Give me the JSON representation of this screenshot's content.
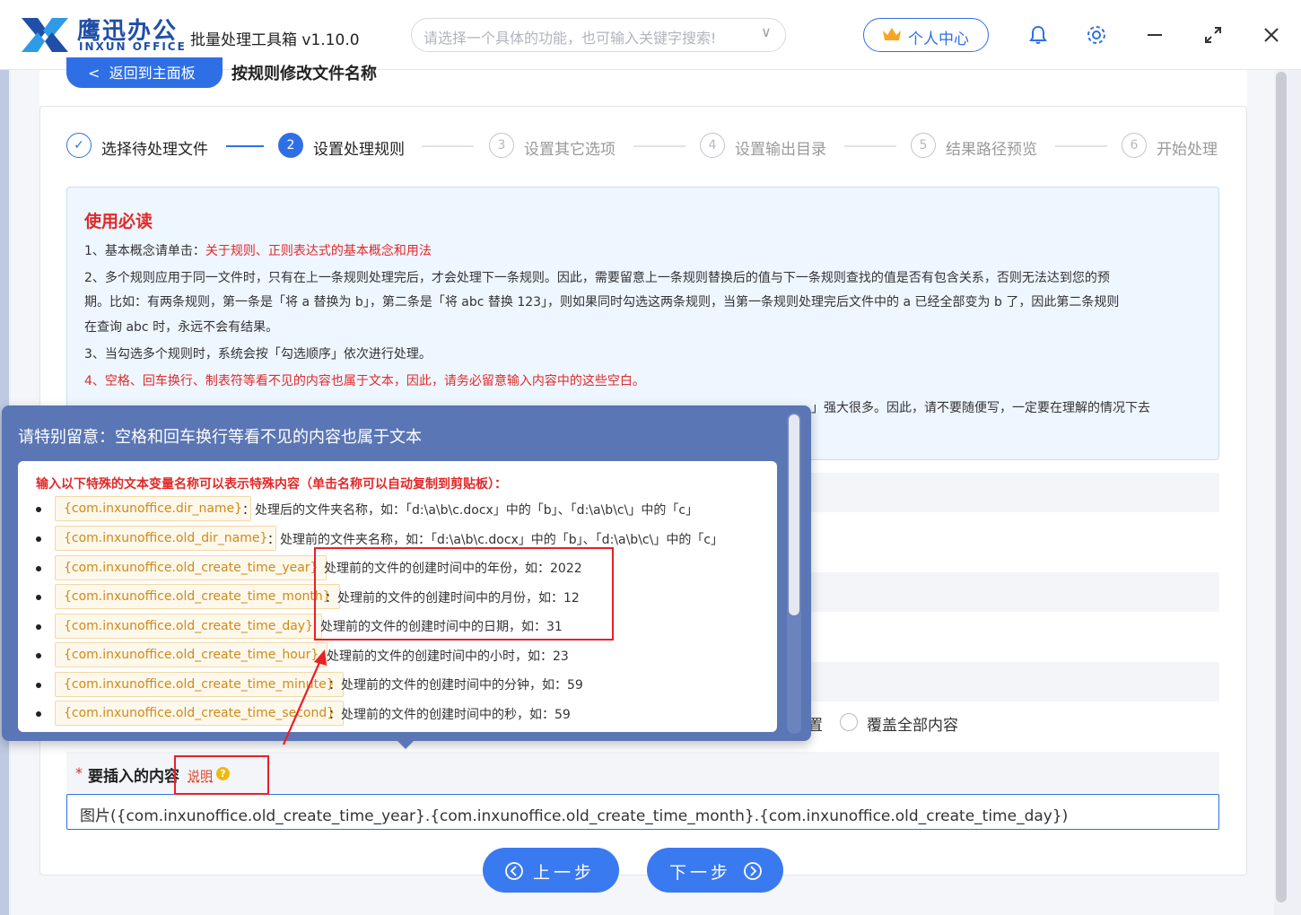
{
  "app": {
    "logo_cn": "鹰迅办公",
    "logo_en": "INXUN OFFICE",
    "name": "批量处理工具箱 v1.10.0",
    "search_placeholder": "请选择一个具体的功能，也可输入关键字搜索!",
    "personal_center": "个人中心",
    "icons": [
      "bell-icon",
      "gear-icon",
      "minimize-icon",
      "expand-icon",
      "close-icon"
    ]
  },
  "header": {
    "back_button": "返回到主面板",
    "page_title": "按规则修改文件名称"
  },
  "steps": [
    {
      "num": "✓",
      "label": "选择待处理文件",
      "state": "done"
    },
    {
      "num": "2",
      "label": "设置处理规则",
      "state": "active"
    },
    {
      "num": "3",
      "label": "设置其它选项",
      "state": "todo"
    },
    {
      "num": "4",
      "label": "设置输出目录",
      "state": "todo"
    },
    {
      "num": "5",
      "label": "结果路径预览",
      "state": "todo"
    },
    {
      "num": "6",
      "label": "开始处理",
      "state": "todo"
    }
  ],
  "notice": {
    "title": "使用必读",
    "line1_prefix": "1、基本概念请单击：",
    "line1_link": "关于规则、正则表达式的基本概念和用法",
    "line2a": "2、多个规则应用于同一文件时，只有在上一条规则处理完后，才会处理下一条规则。因此，需要留意上一条规则替换后的值与下一条规则查找的值是否有包含关系，否则无法达到您的预",
    "line2b": "期。比如：有两条规则，第一条是「将 a 替换为 b」，第二条是「将 abc 替换 123」，则如果同时勾选这两条规则，当第一条规则处理完后文件中的 a 已经全部变为 b 了，因此第二条规则",
    "line2c": "在查询 abc 时，永远不会有结果。",
    "line3": "3、当勾选多个规则时，系统会按「勾选顺序」依次进行处理。",
    "line4": "4、空格、回车换行、制表符等看不见的内容也属于文本，因此，请务必留意输入内容中的这些空白。",
    "line5_tail": "」强大很多。因此，请不要随便写，一定要在理解的情况下去"
  },
  "popup": {
    "title": "请特别留意：空格和回车换行等看不见的内容也属于文本",
    "heading": "输入以下特殊的文本变量名称可以表示特殊内容（单击名称可以自动复制到剪贴板）：",
    "items": [
      {
        "tag": "{com.inxunoffice.dir_name}",
        "desc": "：处理后的文件夹名称，如：「d:\\a\\b\\c.docx」中的「b」、「d:\\a\\b\\c\\」中的「c」"
      },
      {
        "tag": "{com.inxunoffice.old_dir_name}",
        "desc": "：处理前的文件夹名称，如：「d:\\a\\b\\c.docx」中的「b」、「d:\\a\\b\\c\\」中的「c」"
      },
      {
        "tag": "{com.inxunoffice.old_create_time_year}",
        "desc": "处理前的文件的创建时间中的年份，如：2022"
      },
      {
        "tag": "{com.inxunoffice.old_create_time_month}",
        "desc": "：处理前的文件的创建时间中的月份，如：12"
      },
      {
        "tag": "{com.inxunoffice.old_create_time_day}",
        "desc": "处理前的文件的创建时间中的日期，如：31"
      },
      {
        "tag": "{com.inxunoffice.old_create_time_hour}",
        "desc": "处理前的文件的创建时间中的小时，如：23"
      },
      {
        "tag": "{com.inxunoffice.old_create_time_minute}",
        "desc": "：处理前的文件的创建时间中的分钟，如：59"
      },
      {
        "tag": "{com.inxunoffice.old_create_time_second}",
        "desc": "：处理前的文件的创建时间中的秒，如：59"
      }
    ]
  },
  "options": {
    "radio_prev_tail": "置",
    "radio_overwrite": "覆盖全部内容"
  },
  "insert": {
    "star": "*",
    "label": "要插入的内容",
    "explain": "说明",
    "explain_icon": "?",
    "value": "图片({com.inxunoffice.old_create_time_year}.{com.inxunoffice.old_create_time_month}.{com.inxunoffice.old_create_time_day})"
  },
  "nav": {
    "prev": "上一步",
    "next": "下一步"
  },
  "colors": {
    "accent": "#2f6fe6",
    "popup_bg": "#5b76b5",
    "warning_red": "#e02a2a",
    "tag_orange": "#d08a17"
  }
}
